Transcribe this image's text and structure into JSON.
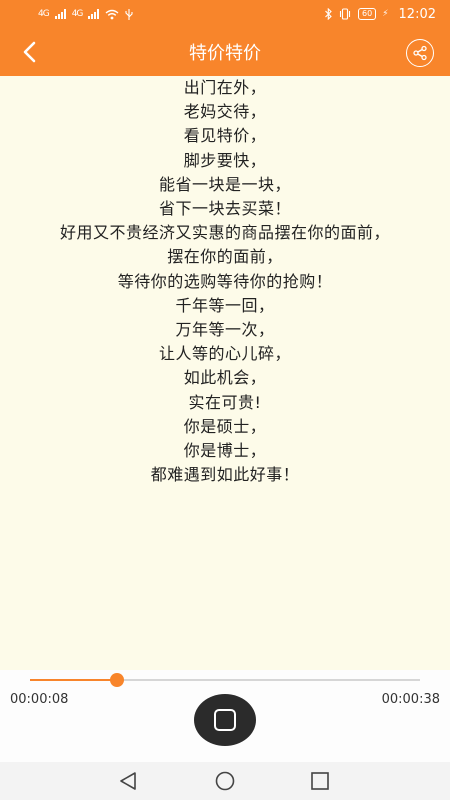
{
  "status_bar": {
    "left_sim1": "4G",
    "left_sim2": "4G",
    "battery": "60",
    "time": "12:02"
  },
  "header": {
    "title": "特价特价",
    "back_icon": "chevron-left-icon",
    "share_icon": "share-icon"
  },
  "poem": {
    "lines": [
      "出门在外，",
      "老妈交待，",
      "看见特价，",
      "脚步要快，",
      "能省一块是一块，",
      "省下一块去买菜！",
      "好用又不贵经济又实惠的商品摆在你的面前，",
      "摆在你的面前，",
      "等待你的选购等待你的抢购！",
      "千年等一回，",
      "万年等一次，",
      "让人等的心儿碎，",
      "如此机会，",
      "实在可贵!",
      "你是硕士，",
      "你是博士，",
      "都难遇到如此好事！"
    ]
  },
  "player": {
    "current_time": "00:00:08",
    "total_time": "00:00:38",
    "progress": 0.2237,
    "stop_icon": "stop-icon"
  },
  "nav": {
    "back_icon": "nav-back-icon",
    "home_icon": "nav-home-icon",
    "recents_icon": "nav-recents-icon"
  },
  "colors": {
    "accent": "#f8852b",
    "content_bg": "#fdfbe9"
  }
}
